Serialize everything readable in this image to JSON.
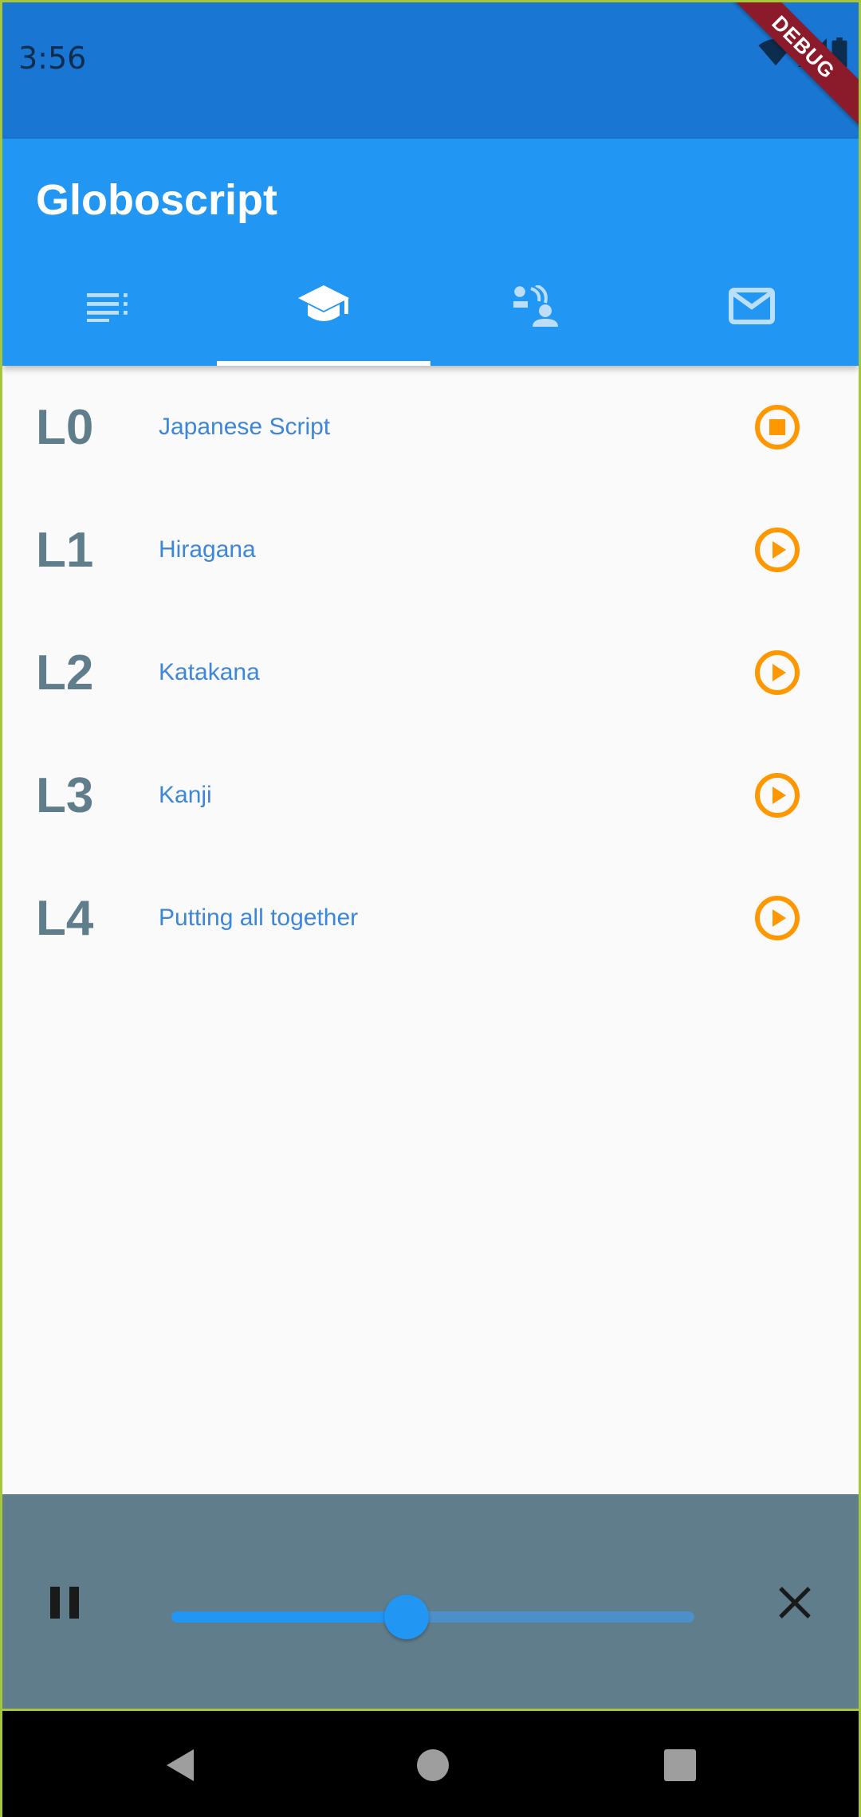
{
  "status_bar": {
    "time": "3:56",
    "debug_label": "DEBUG"
  },
  "app_bar": {
    "title": "Globoscript",
    "tabs": [
      {
        "icon": "list-icon",
        "active": false
      },
      {
        "icon": "school-icon",
        "active": true
      },
      {
        "icon": "speaking-icon",
        "active": false
      },
      {
        "icon": "mail-icon",
        "active": false
      }
    ]
  },
  "lessons": [
    {
      "code": "L0",
      "title": "Japanese Script",
      "state": "stop"
    },
    {
      "code": "L1",
      "title": "Hiragana",
      "state": "play"
    },
    {
      "code": "L2",
      "title": "Katakana",
      "state": "play"
    },
    {
      "code": "L3",
      "title": "Kanji",
      "state": "play"
    },
    {
      "code": "L4",
      "title": "Putting all together",
      "state": "play"
    }
  ],
  "player": {
    "progress": 0.45
  },
  "colors": {
    "primary": "#2196f3",
    "primary_dark": "#1976d2",
    "accent_orange": "#ff9800",
    "lesson_code": "#607d8b",
    "lesson_title": "#3d86d8",
    "player_bg": "#607d8b"
  }
}
